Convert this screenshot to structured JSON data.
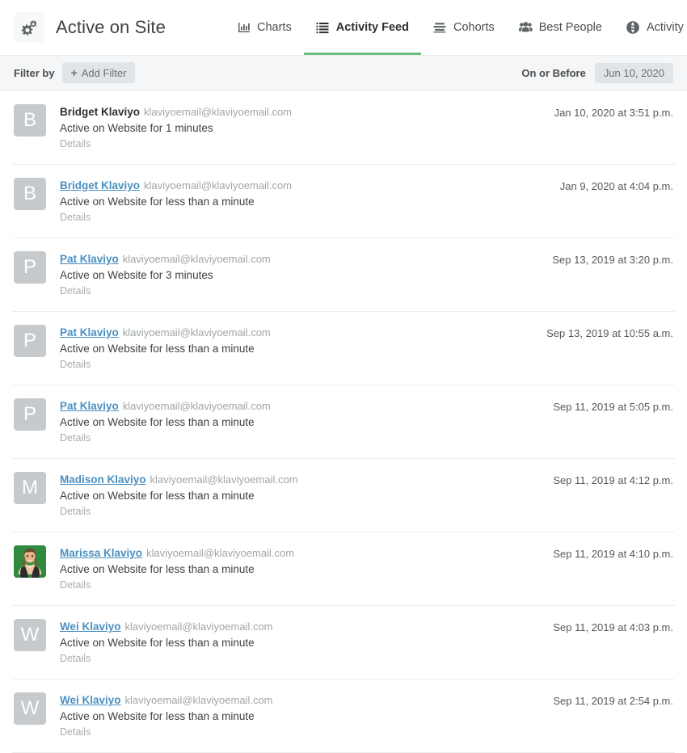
{
  "theme": {
    "accent_green": "#6cbf84",
    "link_blue": "#4a90c2",
    "avatar_gray": "#c6cacc",
    "filter_bar_bg": "#f5f6f7",
    "chip_bg": "#e2e5e7",
    "muted_text": "#a0a5a8"
  },
  "header": {
    "logo_icon": "gears-icon",
    "title": "Active on Site",
    "nav": [
      {
        "label": "Charts",
        "icon": "bar-chart-icon",
        "active": false
      },
      {
        "label": "Activity Feed",
        "icon": "list-icon",
        "active": true
      },
      {
        "label": "Cohorts",
        "icon": "rows-icon",
        "active": false
      },
      {
        "label": "Best People",
        "icon": "people-icon",
        "active": false
      },
      {
        "label": "Activity Map",
        "icon": "globe-icon",
        "active": false
      }
    ]
  },
  "filter_bar": {
    "filter_by_label": "Filter by",
    "add_filter_label": "Add Filter",
    "add_filter_icon": "plus-icon",
    "on_or_before_label": "On or Before",
    "date_value": "Jun 10, 2020"
  },
  "feed": {
    "details_label": "Details",
    "rows": [
      {
        "avatar_type": "initial",
        "avatar_initial": "B",
        "name": "Bridget Klaviyo",
        "name_is_link": false,
        "email": "klaviyoemail@klaviyoemail.com",
        "activity": "Active on Website for 1 minutes",
        "details": "Details",
        "timestamp": "Jan 10, 2020 at 3:51 p.m."
      },
      {
        "avatar_type": "initial",
        "avatar_initial": "B",
        "name": "Bridget Klaviyo",
        "name_is_link": true,
        "email": "klaviyoemail@klaviyoemail.com",
        "activity": "Active on Website for less than a minute",
        "details": "Details",
        "timestamp": "Jan 9, 2020 at 4:04 p.m."
      },
      {
        "avatar_type": "initial",
        "avatar_initial": "P",
        "name": "Pat Klaviyo",
        "name_is_link": true,
        "email": "klaviyoemail@klaviyoemail.com",
        "activity": "Active on Website for 3 minutes",
        "details": "Details",
        "timestamp": "Sep 13, 2019 at 3:20 p.m."
      },
      {
        "avatar_type": "initial",
        "avatar_initial": "P",
        "name": "Pat Klaviyo",
        "name_is_link": true,
        "email": "klaviyoemail@klaviyoemail.com",
        "activity": "Active on Website for less than a minute",
        "details": "Details",
        "timestamp": "Sep 13, 2019 at 10:55 a.m."
      },
      {
        "avatar_type": "initial",
        "avatar_initial": "P",
        "name": "Pat Klaviyo",
        "name_is_link": true,
        "email": "klaviyoemail@klaviyoemail.com",
        "activity": "Active on Website for less than a minute",
        "details": "Details",
        "timestamp": "Sep 11, 2019 at 5:05 p.m."
      },
      {
        "avatar_type": "initial",
        "avatar_initial": "M",
        "name": "Madison Klaviyo",
        "name_is_link": true,
        "email": "klaviyoemail@klaviyoemail.com",
        "activity": "Active on Website for less than a minute",
        "details": "Details",
        "timestamp": "Sep 11, 2019 at 4:12 p.m."
      },
      {
        "avatar_type": "photo",
        "avatar_initial": "",
        "name": "Marissa Klaviyo",
        "name_is_link": true,
        "email": "klaviyoemail@klaviyoemail.com",
        "activity": "Active on Website for less than a minute",
        "details": "Details",
        "timestamp": "Sep 11, 2019 at 4:10 p.m."
      },
      {
        "avatar_type": "initial",
        "avatar_initial": "W",
        "name": "Wei Klaviyo",
        "name_is_link": true,
        "email": "klaviyoemail@klaviyoemail.com",
        "activity": "Active on Website for less than a minute",
        "details": "Details",
        "timestamp": "Sep 11, 2019 at 4:03 p.m."
      },
      {
        "avatar_type": "initial",
        "avatar_initial": "W",
        "name": "Wei Klaviyo",
        "name_is_link": true,
        "email": "klaviyoemail@klaviyoemail.com",
        "activity": "Active on Website for less than a minute",
        "details": "Details",
        "timestamp": "Sep 11, 2019 at 2:54 p.m."
      }
    ]
  }
}
